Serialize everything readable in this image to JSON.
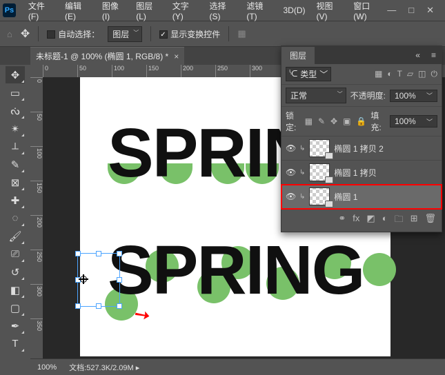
{
  "menubar": [
    "文件(F)",
    "编辑(E)",
    "图像(I)",
    "图层(L)",
    "文字(Y)",
    "选择(S)",
    "滤镜(T)",
    "3D(D)",
    "视图(V)",
    "窗口(W)"
  ],
  "options": {
    "auto_select_label": "自动选择：",
    "auto_select_target": "图层",
    "show_transform_label": "显示变换控件"
  },
  "doc_tab": {
    "title": "未标题-1 @ 100% (椭圆 1, RGB/8) *"
  },
  "ruler_h": [
    "0",
    "50",
    "100",
    "150",
    "200",
    "250",
    "300"
  ],
  "ruler_v": [
    "0",
    "50",
    "100",
    "150",
    "200",
    "250",
    "300",
    "350"
  ],
  "canvas_text": {
    "line1": "SPRING",
    "line2": "SPRING"
  },
  "layers_panel": {
    "title": "图层",
    "kind_label": "类型",
    "blend_mode": "正常",
    "opacity_label": "不透明度:",
    "opacity_value": "100%",
    "lock_label": "锁定:",
    "fill_label": "填充:",
    "fill_value": "100%",
    "items": [
      {
        "name": "椭圆 1 拷贝 2"
      },
      {
        "name": "椭圆 1 拷贝"
      },
      {
        "name": "椭圆 1"
      }
    ]
  },
  "status": {
    "zoom": "100%",
    "doc_label": "文档:",
    "doc_size": "527.3K/2.09M"
  }
}
